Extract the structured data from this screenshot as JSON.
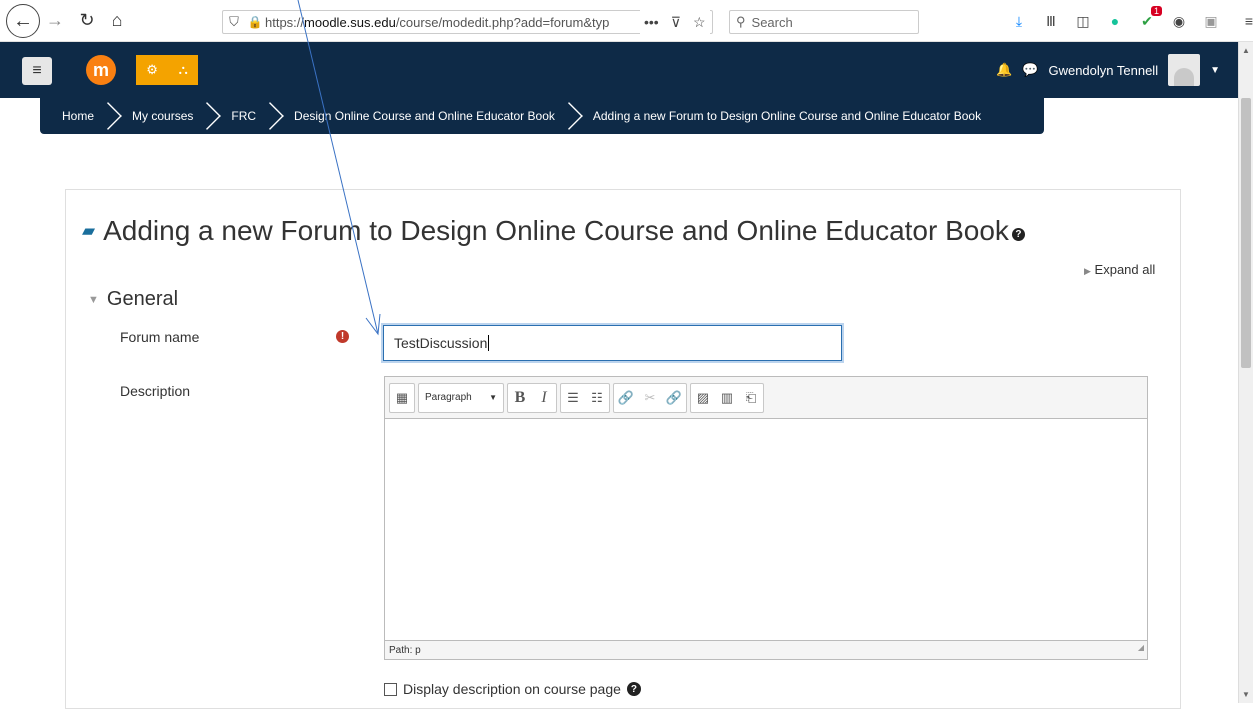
{
  "browser": {
    "url_prefix": "https://",
    "url_host": "moodle.sus.edu",
    "url_path": "/course/modedit.php?add=forum&typ",
    "page_actions": "•••",
    "search_placeholder": "Search"
  },
  "navbar": {
    "user_name": "Gwendolyn Tennell"
  },
  "breadcrumb": [
    "Home",
    "My courses",
    "FRC",
    "Design Online Course and Online Educator Book",
    "Adding a new Forum to Design Online Course and Online Educator Book"
  ],
  "page": {
    "title": "Adding a new Forum to Design Online Course and Online Educator Book",
    "expand_all": "Expand all",
    "section_general": "General",
    "forum_name_label": "Forum name",
    "forum_name_value": "TestDiscussion",
    "description_label": "Description",
    "editor_format": "Paragraph",
    "editor_path": "Path: p",
    "display_description": "Display description on course page"
  }
}
